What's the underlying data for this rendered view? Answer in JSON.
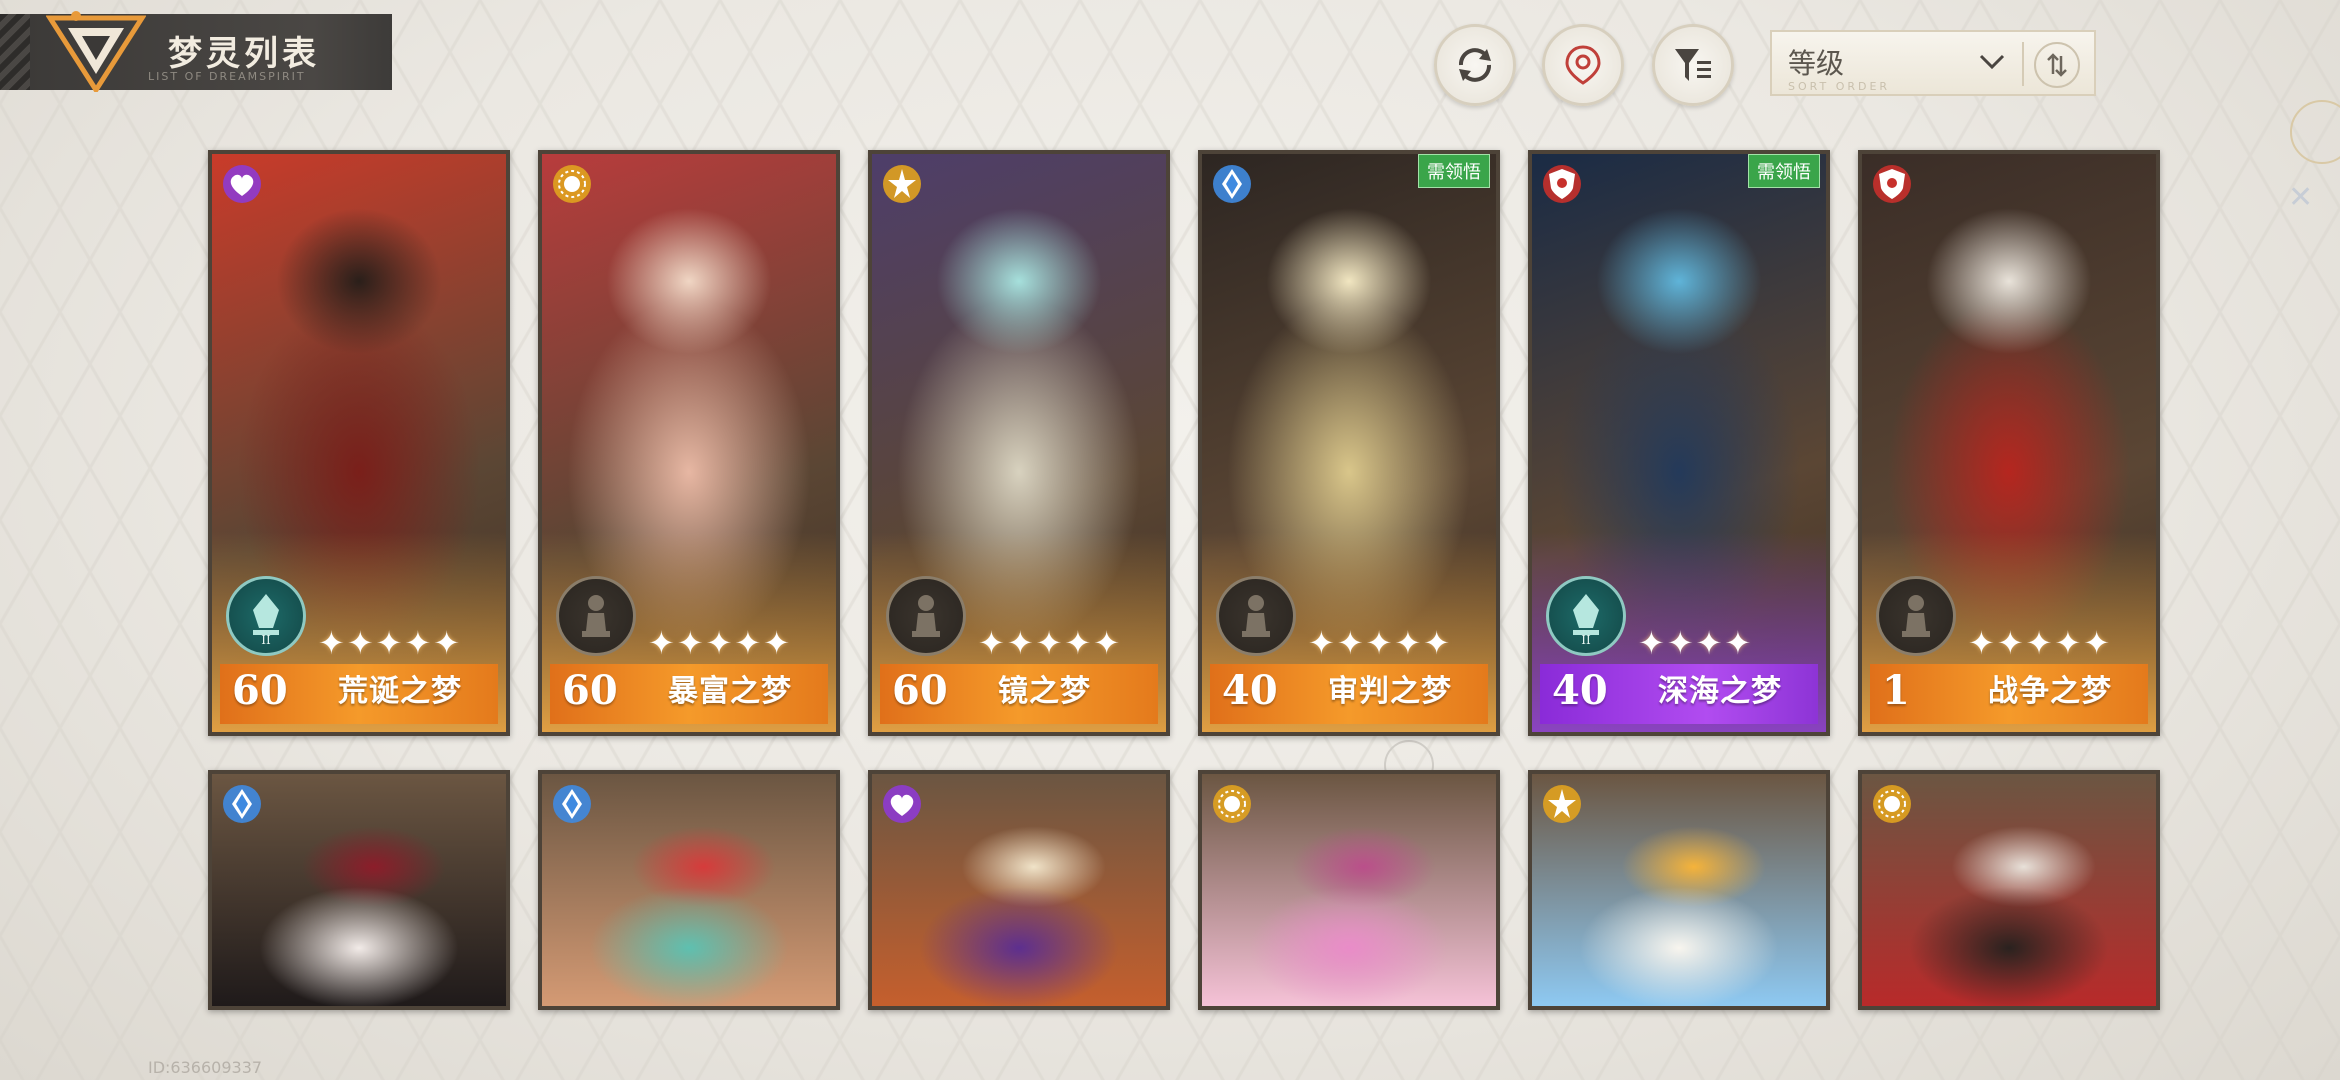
{
  "header": {
    "title": "梦灵列表",
    "subtitle": "LIST OF DREAMSPIRIT"
  },
  "toolbar": {
    "refresh_icon": "refresh-icon",
    "locate_icon": "locate-icon",
    "filter_icon": "filter-icon",
    "sort": {
      "label": "等级",
      "sub": "SORT ORDER",
      "order_icon": "sort-order-icon"
    }
  },
  "cards": [
    {
      "level": "60",
      "name": "荒诞之梦",
      "stars": 5,
      "element": "heart",
      "rank": "teal",
      "tag": "",
      "bar": "orange",
      "colors": [
        "#7a1f1a",
        "#c93b2a",
        "#2a1f1a"
      ]
    },
    {
      "level": "60",
      "name": "暴富之梦",
      "stars": 5,
      "element": "sun",
      "rank": "pawn",
      "tag": "",
      "bar": "orange",
      "colors": [
        "#e7b7a3",
        "#b83c3c",
        "#f0d6c4"
      ]
    },
    {
      "level": "60",
      "name": "镜之梦",
      "stars": 5,
      "element": "star",
      "rank": "pawn",
      "tag": "",
      "bar": "orange",
      "colors": [
        "#d8d2bf",
        "#4e3e6a",
        "#a6e0dc"
      ]
    },
    {
      "level": "40",
      "name": "审判之梦",
      "stars": 5,
      "element": "crystal",
      "rank": "pawn",
      "tag": "需领悟",
      "bar": "orange",
      "colors": [
        "#d9c68a",
        "#2d2622",
        "#f1e6c1"
      ]
    },
    {
      "level": "40",
      "name": "深海之梦",
      "stars": 4,
      "element": "shield",
      "rank": "teal",
      "tag": "需领悟",
      "bar": "purple",
      "colors": [
        "#243a5a",
        "#1a2b45",
        "#5fb4d9"
      ]
    },
    {
      "level": "1",
      "name": "战争之梦",
      "stars": 5,
      "element": "shield",
      "rank": "pawn",
      "tag": "",
      "bar": "orange",
      "colors": [
        "#b5261f",
        "#3a2d27",
        "#e9e3da"
      ]
    }
  ],
  "cards_row2": [
    {
      "element": "crystal",
      "colors": [
        "#f2ebe8",
        "#8c1d2a",
        "#1f1a1a"
      ]
    },
    {
      "element": "crystal",
      "colors": [
        "#5ec0b0",
        "#d63b3b",
        "#d49a74"
      ]
    },
    {
      "element": "heart",
      "colors": [
        "#5d2f8f",
        "#f0e3c8",
        "#c55f2d"
      ]
    },
    {
      "element": "sun",
      "colors": [
        "#e98cc8",
        "#ba4f8a",
        "#f5c2d7"
      ]
    },
    {
      "element": "star",
      "colors": [
        "#f8f5ee",
        "#f5b33a",
        "#8ec9f2"
      ]
    },
    {
      "element": "sun",
      "colors": [
        "#2a221f",
        "#e8e1d9",
        "#b82a2a"
      ]
    }
  ],
  "footer": {
    "id": "ID:636609337"
  }
}
